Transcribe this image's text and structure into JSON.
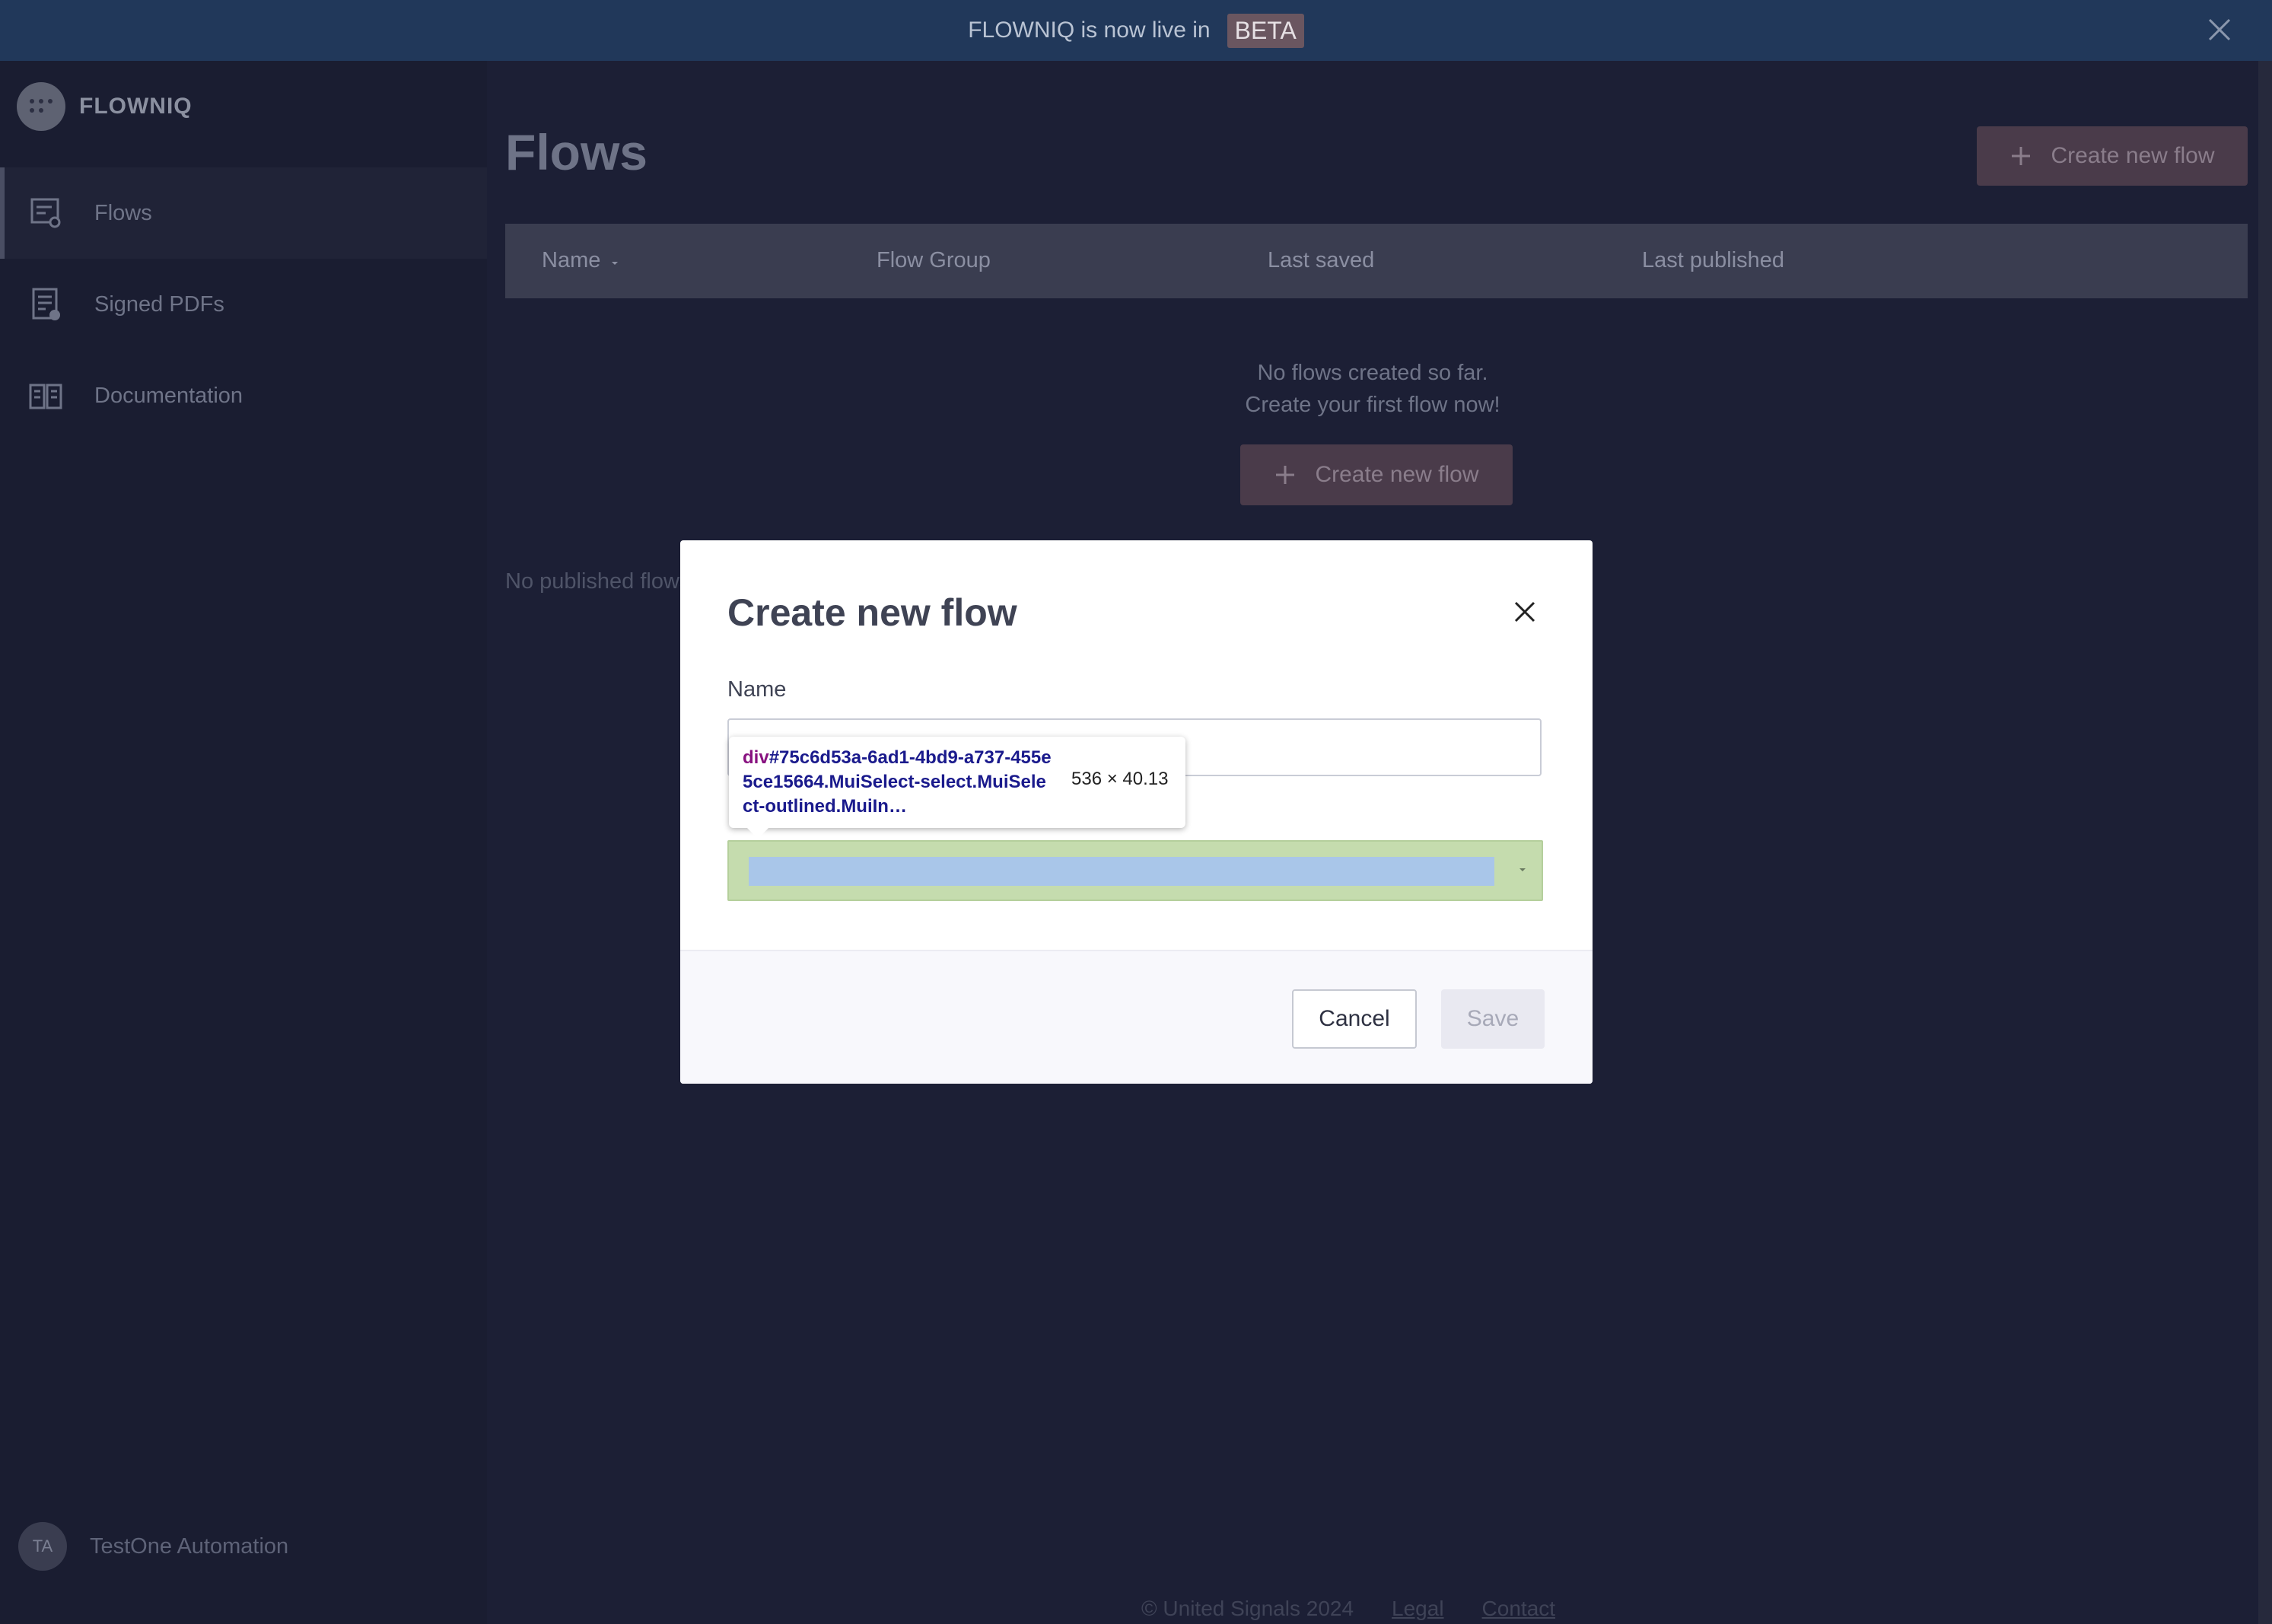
{
  "banner": {
    "text": "FLOWNIQ is now live in",
    "badge": "BETA"
  },
  "brand": {
    "name": "FLOWNIQ"
  },
  "sidebar": {
    "items": [
      {
        "label": "Flows",
        "icon": "flows-icon",
        "active": true
      },
      {
        "label": "Signed PDFs",
        "icon": "signed-pdf-icon",
        "active": false
      },
      {
        "label": "Documentation",
        "icon": "documentation-book-icon",
        "active": false
      }
    ],
    "user": {
      "initials": "TA",
      "name": "TestOne Automation"
    }
  },
  "main": {
    "title": "Flows",
    "create_button": "Create new flow",
    "table": {
      "columns": [
        "Name",
        "Flow Group",
        "Last saved",
        "Last published"
      ]
    },
    "empty": {
      "line1": "No flows created so far.",
      "line2": "Create your first flow now!",
      "button": "Create new flow"
    },
    "no_published": "No published flows"
  },
  "footer": {
    "copyright": "© United Signals 2024",
    "legal": "Legal",
    "contact": "Contact"
  },
  "modal": {
    "title": "Create new flow",
    "name_label": "Name",
    "name_value": "",
    "select_value": "",
    "cancel": "Cancel",
    "save": "Save"
  },
  "devtools_tooltip": {
    "tag": "div",
    "selector": "#75c6d53a-6ad1-4bd9-a737-455e5ce15664.MuiSelect-select.MuiSelect-outlined.MuiIn…",
    "dimensions": "536 × 40.13"
  },
  "colors": {
    "background": "#1c1f35",
    "banner": "#21385a",
    "accent_button": "#4a3b4a",
    "select_highlight": "#c5dcae",
    "select_content_highlight": "#a9c6e9"
  }
}
